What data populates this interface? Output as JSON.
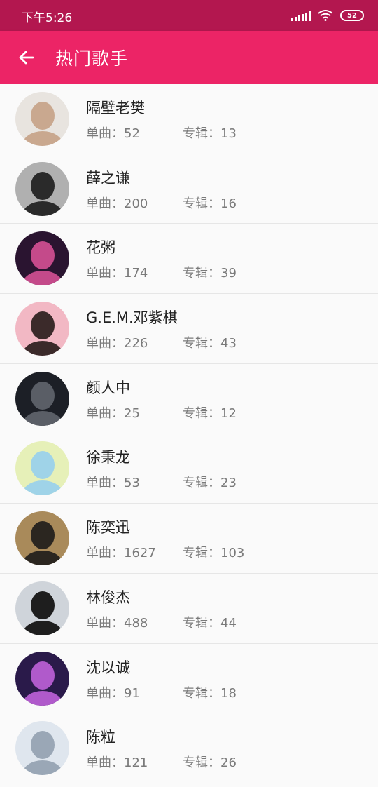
{
  "status_bar": {
    "time": "下午5:26",
    "battery": "52"
  },
  "app_bar": {
    "title": "热门歌手"
  },
  "singers": [
    {
      "name": "隔壁老樊",
      "singles": "单曲：52",
      "albums": "专辑：13",
      "avatar_bg": "#e8e4df",
      "avatar_fg": "#c9a88f"
    },
    {
      "name": "薛之谦",
      "singles": "单曲：200",
      "albums": "专辑：16",
      "avatar_bg": "#b0b0b0",
      "avatar_fg": "#2a2a2a"
    },
    {
      "name": "花粥",
      "singles": "单曲：174",
      "albums": "专辑：39",
      "avatar_bg": "#2a1430",
      "avatar_fg": "#c44a8a"
    },
    {
      "name": "G.E.M.邓紫棋",
      "singles": "单曲：226",
      "albums": "专辑：43",
      "avatar_bg": "#f2b8c4",
      "avatar_fg": "#3b2a2a"
    },
    {
      "name": "颜人中",
      "singles": "单曲：25",
      "albums": "专辑：12",
      "avatar_bg": "#1c1f26",
      "avatar_fg": "#5a5e66"
    },
    {
      "name": "徐秉龙",
      "singles": "单曲：53",
      "albums": "专辑：23",
      "avatar_bg": "#e6f0b8",
      "avatar_fg": "#9fd3e8"
    },
    {
      "name": "陈奕迅",
      "singles": "单曲：1627",
      "albums": "专辑：103",
      "avatar_bg": "#a98a5a",
      "avatar_fg": "#2b2620"
    },
    {
      "name": "林俊杰",
      "singles": "单曲：488",
      "albums": "专辑：44",
      "avatar_bg": "#cfd4da",
      "avatar_fg": "#1e1e1e"
    },
    {
      "name": "沈以诚",
      "singles": "单曲：91",
      "albums": "专辑：18",
      "avatar_bg": "#2a1a4a",
      "avatar_fg": "#b05acb"
    },
    {
      "name": "陈粒",
      "singles": "单曲：121",
      "albums": "专辑：26",
      "avatar_bg": "#dfe6ee",
      "avatar_fg": "#9aa7b6"
    }
  ]
}
